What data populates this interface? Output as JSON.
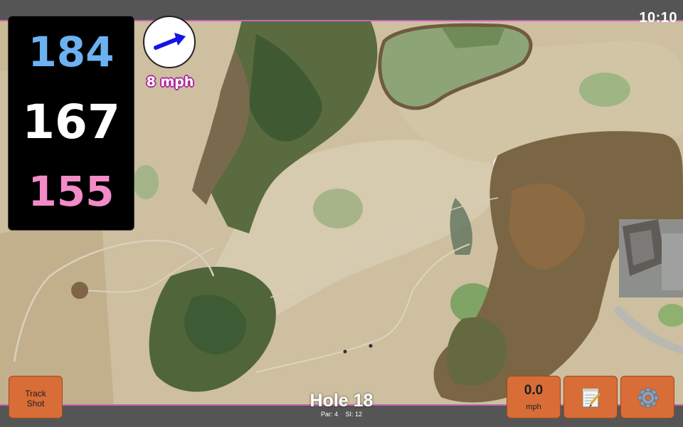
{
  "status_bar": {
    "time": "10:10"
  },
  "yardages": {
    "back": "184",
    "center": "167",
    "front": "155"
  },
  "wind": {
    "speed_label": "8 mph",
    "direction_icon": "arrow-icon",
    "arrow_color": "#1414e6"
  },
  "hole": {
    "title": "Hole 18",
    "par_label": "Par: 4",
    "si_label": "SI: 12"
  },
  "buttons": {
    "track_shot_line1": "Track",
    "track_shot_line2": "Shot",
    "speed_value": "0.0",
    "speed_unit": "mph",
    "notes_icon": "notepad-icon",
    "settings_icon": "gear-icon"
  },
  "colors": {
    "back_yardage": "#6cb2f2",
    "center_yardage": "#ffffff",
    "front_yardage": "#f28bc8",
    "button_fill": "#d86d38",
    "wind_outline": "#b0289e"
  }
}
